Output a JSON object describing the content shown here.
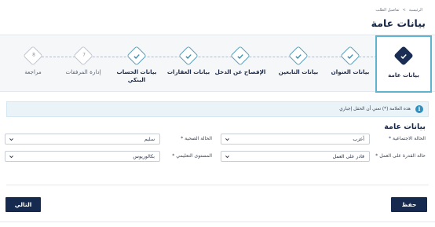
{
  "breadcrumb": {
    "home": "الرئيسية",
    "separator": ">",
    "current": "تفاصيل الطلب"
  },
  "page_title": "بيانات عامة",
  "steps": [
    {
      "label": "بيانات عامة",
      "state": "active",
      "icon": "check-icon"
    },
    {
      "label": "بيانات العنوان",
      "state": "done",
      "icon": "check-icon"
    },
    {
      "label": "بيانات التابعين",
      "state": "done",
      "icon": "check-icon"
    },
    {
      "label": "الإفصاح عن الدخل",
      "state": "done",
      "icon": "check-icon"
    },
    {
      "label": "بيانات العقارات",
      "state": "done",
      "icon": "check-icon"
    },
    {
      "label": "بيانات الحساب البنكي",
      "state": "done",
      "icon": "check-icon"
    },
    {
      "label": "إدارة المرفقات",
      "state": "pending",
      "number": "7"
    },
    {
      "label": "مراجعة",
      "state": "pending",
      "number": "8"
    }
  ],
  "info": {
    "text": "هذه العلامة (*) تعني أن الحقل إجباري",
    "icon": "info-icon"
  },
  "form": {
    "section_title": "بيانات عامة",
    "marital_status": {
      "label": "الحالة الاجتماعية *",
      "value": "أعزب"
    },
    "health_status": {
      "label": "الحالة الصحية *",
      "value": "سليم"
    },
    "work_ability": {
      "label": "حالة القدرة على العمل *",
      "value": "قادر على العمل"
    },
    "education_level": {
      "label": "المستوى التعليمي *",
      "value": "بكالوريوس"
    }
  },
  "buttons": {
    "save": "حفظ",
    "next": "التالي"
  },
  "colors": {
    "primary": "#16294f",
    "accent": "#5eb4cf",
    "info_bg": "#e9f3f8"
  }
}
